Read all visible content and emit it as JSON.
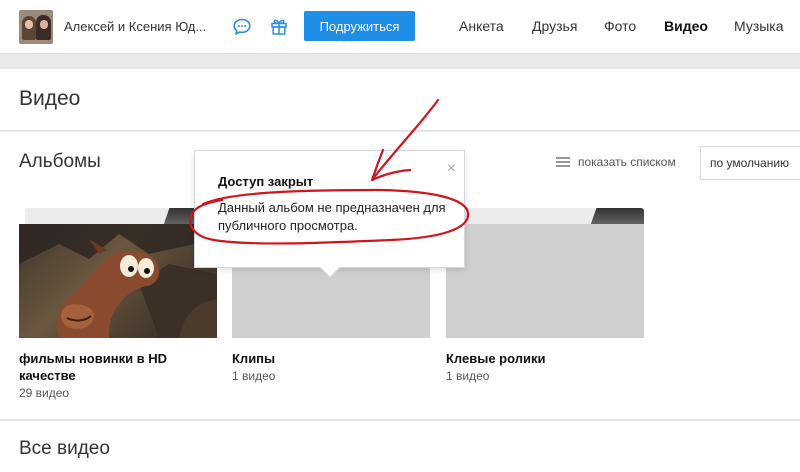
{
  "header": {
    "user_name": "Алексей и Ксения Юд...",
    "befriend_label": "Подружиться",
    "nav": [
      {
        "label": "Анкета",
        "active": false
      },
      {
        "label": "Друзья",
        "active": false
      },
      {
        "label": "Фото",
        "active": false
      },
      {
        "label": "Видео",
        "active": true
      },
      {
        "label": "Музыка",
        "active": false
      }
    ]
  },
  "page": {
    "title": "Видео"
  },
  "albums": {
    "title": "Альбомы",
    "list_toggle_label": "показать списком",
    "sort_value": "по умолчанию",
    "items": [
      {
        "name": "фильмы новинки в HD качестве",
        "count": "29 видео"
      },
      {
        "name": "Клипы",
        "count": "1 видео"
      },
      {
        "name": "Клевые ролики",
        "count": "1 видео"
      }
    ]
  },
  "all_videos": {
    "title": "Все видео"
  },
  "popup": {
    "title": "Доступ закрыт",
    "text": "Данный альбом не предназначен для публичного просмотра.",
    "close_glyph": "×"
  },
  "colors": {
    "accent": "#1e8ee6",
    "annotation": "#d0161a"
  }
}
